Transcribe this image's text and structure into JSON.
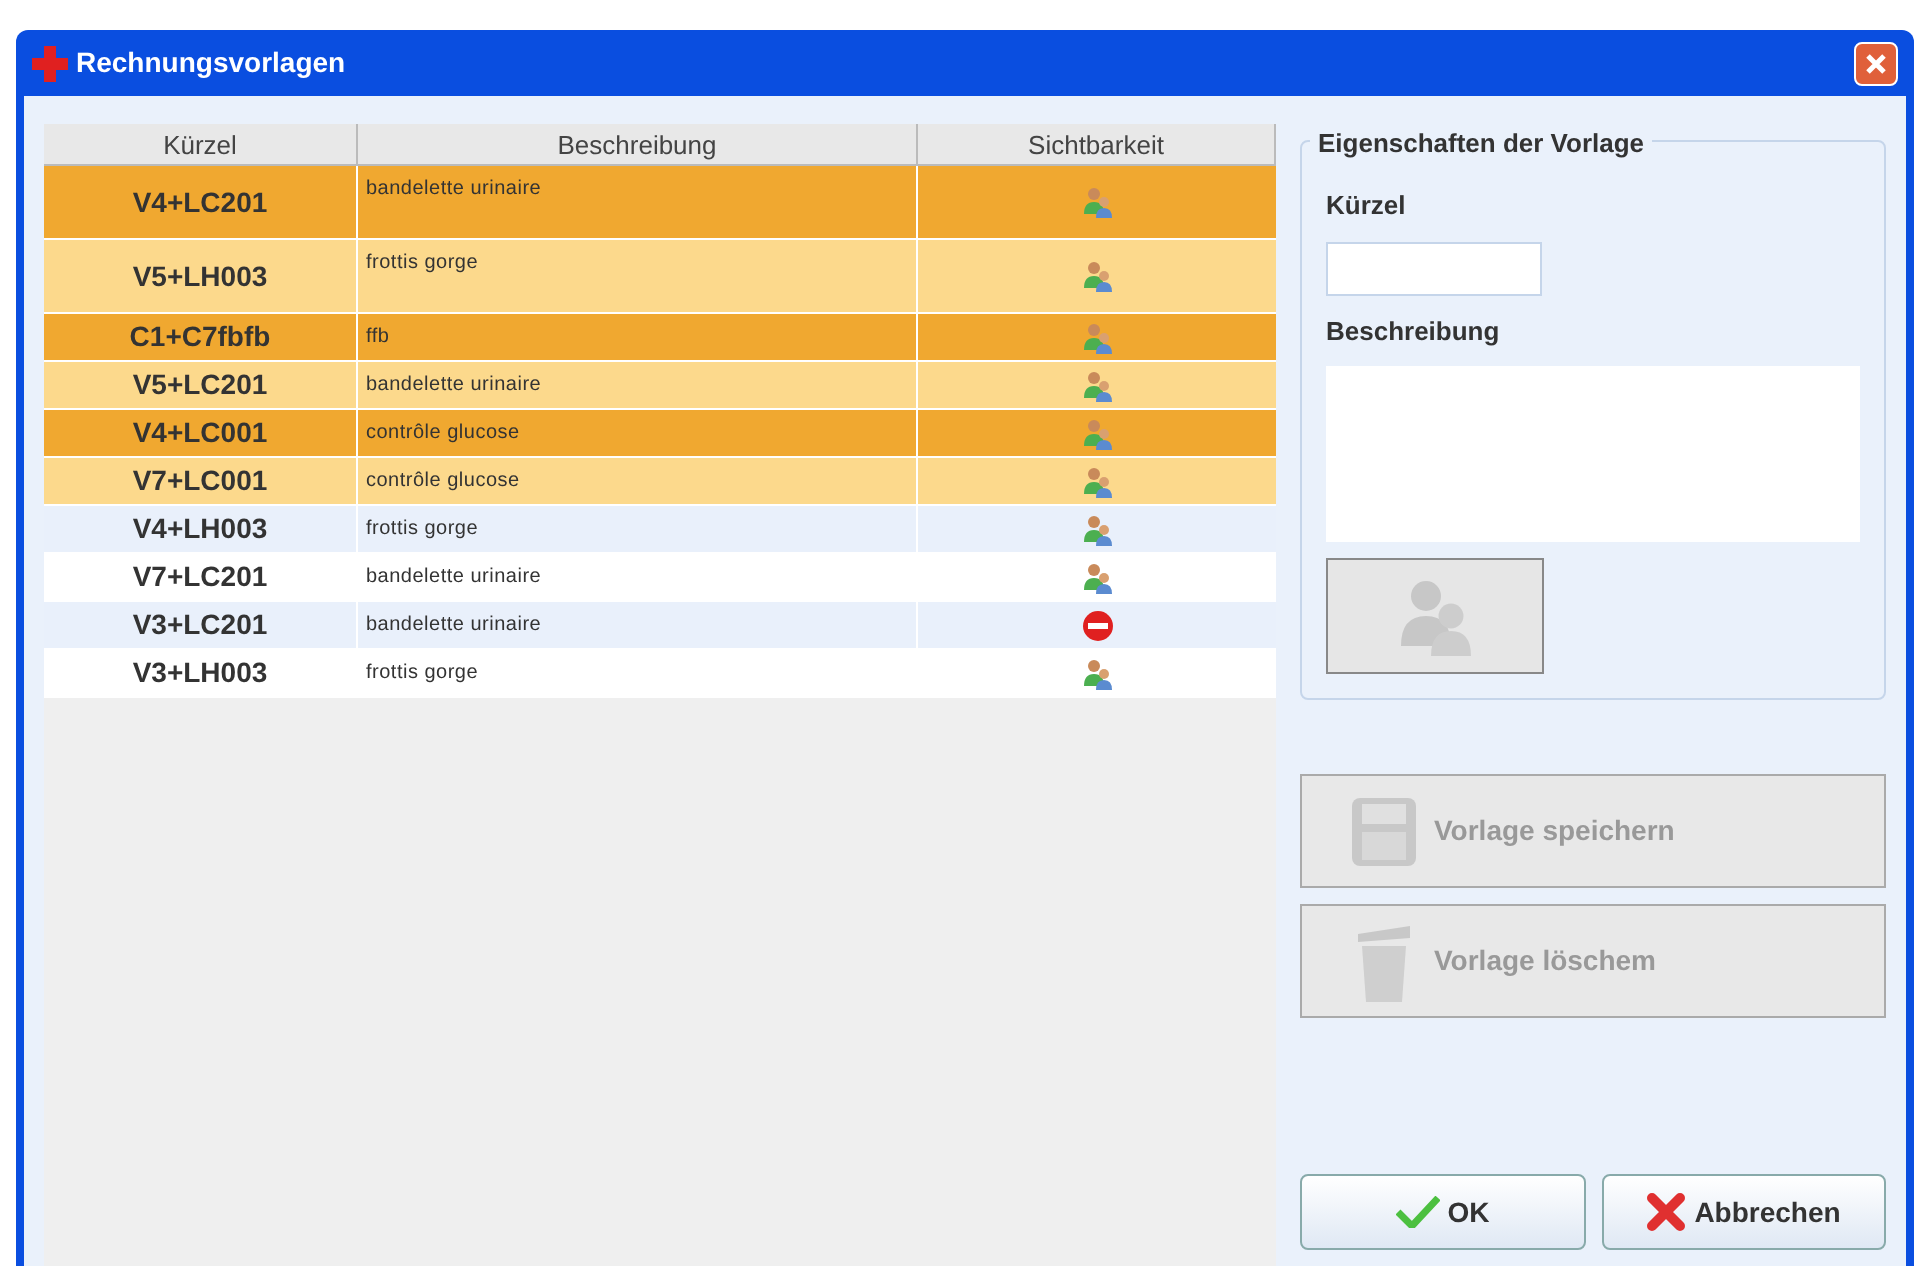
{
  "window": {
    "title": "Rechnungsvorlagen"
  },
  "table": {
    "columns": [
      "Kürzel",
      "Beschreibung",
      "Sichtbarkeit"
    ],
    "rows": [
      {
        "code": "V4+LC201",
        "description": "bandelette urinaire",
        "kind": "shared",
        "highlighted": true
      },
      {
        "code": "V5+LH003",
        "description": "frottis gorge",
        "kind": "shared",
        "highlighted": true
      },
      {
        "code": "C1+C7fbfb",
        "description": "ffb",
        "kind": "shared",
        "highlighted": true
      },
      {
        "code": "V5+LC201",
        "description": "bandelette urinaire",
        "kind": "shared",
        "highlighted": true
      },
      {
        "code": "V4+LC001",
        "description": "contrôle glucose",
        "kind": "shared",
        "highlighted": true
      },
      {
        "code": "V7+LC001",
        "description": "contrôle glucose",
        "kind": "shared",
        "highlighted": true
      },
      {
        "code": "V4+LH003",
        "description": "frottis gorge",
        "kind": "shared",
        "highlighted": false
      },
      {
        "code": "V7+LC201",
        "description": "bandelette urinaire",
        "kind": "shared",
        "highlighted": false
      },
      {
        "code": "V3+LC201",
        "description": "bandelette urinaire",
        "kind": "blocked",
        "highlighted": false
      },
      {
        "code": "V3+LH003",
        "description": "frottis gorge",
        "kind": "shared",
        "highlighted": false
      }
    ]
  },
  "properties": {
    "title": "Eigenschaften der Vorlage",
    "code_label": "Kürzel",
    "description_label": "Beschreibung",
    "visibility_button_disabled": true
  },
  "actions": [
    {
      "kind": "save",
      "label": "Vorlage speichern",
      "disabled": true
    },
    {
      "kind": "delete",
      "label": "Vorlage löschem",
      "disabled": true
    }
  ],
  "footer_buttons": [
    {
      "kind": "ok",
      "label": "OK"
    },
    {
      "kind": "cancel",
      "label": "Abbrechen"
    }
  ]
}
